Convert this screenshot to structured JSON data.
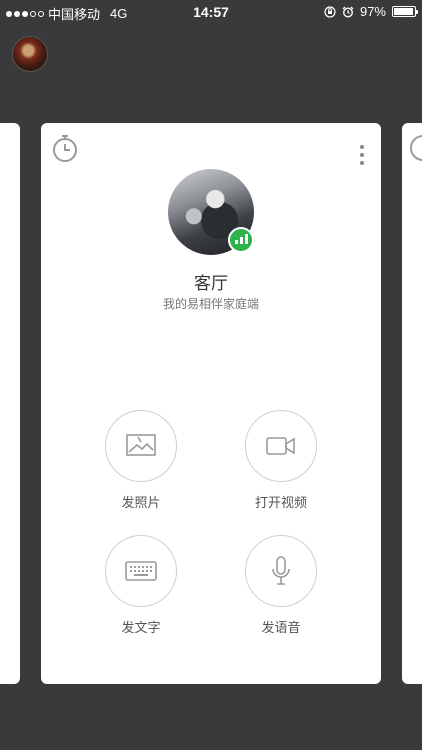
{
  "status_bar": {
    "carrier": "中国移动",
    "network": "4G",
    "time": "14:57",
    "battery": "97%",
    "battery_level": 0.97
  },
  "card": {
    "device_name": "客厅",
    "device_subtitle": "我的易相伴家庭端",
    "online_color": "#2db34a",
    "actions": [
      {
        "label": "发照片",
        "icon": "photo-icon"
      },
      {
        "label": "打开视频",
        "icon": "video-camera-icon"
      },
      {
        "label": "发文字",
        "icon": "keyboard-icon"
      },
      {
        "label": "发语音",
        "icon": "microphone-icon"
      }
    ]
  },
  "colors": {
    "background": "#3a3a3c",
    "card": "#ffffff",
    "icon_stroke": "#9a9a9a"
  }
}
